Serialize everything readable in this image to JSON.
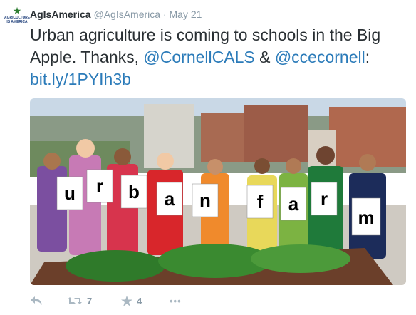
{
  "tweet": {
    "author_name": "AgIsAmerica",
    "author_handle": "@AgIsAmerica",
    "separator": "·",
    "date": "May 21",
    "avatar_text": "AGRICULTURE IS AMERICA",
    "text_plain_1": "Urban agriculture is coming to schools in the Big Apple. Thanks, ",
    "mention_1": "@CornellCALS",
    "text_plain_2": " & ",
    "mention_2": "@ccecornell",
    "text_plain_3": ": ",
    "link": "bit.ly/1PYIh3b",
    "photo_letters": [
      "u",
      "r",
      "b",
      "a",
      "n",
      "f",
      "a",
      "r",
      "m"
    ],
    "actions": {
      "retweet_count": "7",
      "favorite_count": "4",
      "more_label": "•••"
    }
  },
  "colors": {
    "link": "#2b7bb9",
    "text": "#292f33",
    "meta": "#8899a6"
  }
}
